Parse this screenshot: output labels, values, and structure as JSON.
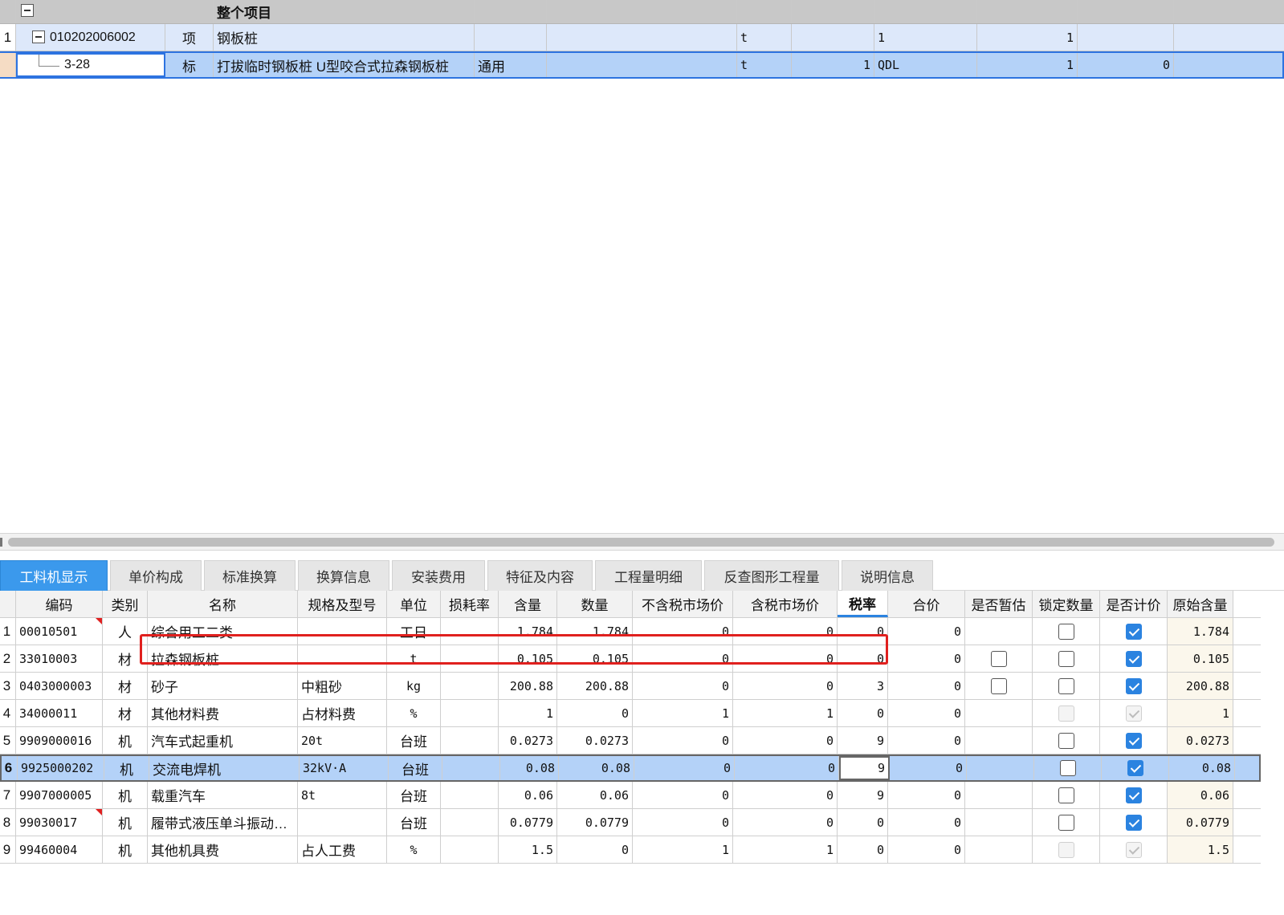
{
  "top_grid": {
    "header_title": "整个项目",
    "rows": [
      {
        "index": "1",
        "code": "010202006002",
        "category": "项",
        "name": "钢板桩",
        "spec": "",
        "col5": "",
        "unit": "t",
        "col7": "",
        "col8": "1",
        "col9": "1",
        "col10": ""
      },
      {
        "index": "",
        "code": "3-28",
        "category": "标",
        "name": "打拔临时钢板桩 U型咬合式拉森钢板桩",
        "spec": "通用",
        "col5": "",
        "unit": "t",
        "col7": "1",
        "col8": "QDL",
        "col9": "1",
        "col10": "0"
      }
    ]
  },
  "tabs": [
    "工料机显示",
    "单价构成",
    "标准换算",
    "换算信息",
    "安装费用",
    "特征及内容",
    "工程量明细",
    "反查图形工程量",
    "说明信息"
  ],
  "active_tab": "工料机显示",
  "bottom_grid": {
    "headers": [
      "编码",
      "类别",
      "名称",
      "规格及型号",
      "单位",
      "损耗率",
      "含量",
      "数量",
      "不含税市场价",
      "含税市场价",
      "税率",
      "合价",
      "是否暂估",
      "锁定数量",
      "是否计价",
      "原始含量"
    ],
    "rows": [
      {
        "index": "1",
        "code": "00010501",
        "type": "人",
        "name": "综合用工二类",
        "spec": "",
        "unit": "工日",
        "loss": "",
        "qty_per": "1.784",
        "qty": "1.784",
        "price_ex": "0",
        "price_in": "0",
        "tax": "0",
        "total": "0",
        "est": "none",
        "lock": "off",
        "priced": "on",
        "orig": "1.784"
      },
      {
        "index": "2",
        "code": "33010003",
        "type": "材",
        "name": "拉森钢板桩",
        "spec": "",
        "unit": "t",
        "loss": "",
        "qty_per": "0.105",
        "qty": "0.105",
        "price_ex": "0",
        "price_in": "0",
        "tax": "0",
        "total": "0",
        "est": "off",
        "lock": "off",
        "priced": "on",
        "orig": "0.105"
      },
      {
        "index": "3",
        "code": "0403000003",
        "type": "材",
        "name": "砂子",
        "spec": "中粗砂",
        "unit": "kg",
        "loss": "",
        "qty_per": "200.88",
        "qty": "200.88",
        "price_ex": "0",
        "price_in": "0",
        "tax": "3",
        "total": "0",
        "est": "off",
        "lock": "off",
        "priced": "on",
        "orig": "200.88"
      },
      {
        "index": "4",
        "code": "34000011",
        "type": "材",
        "name": "其他材料费",
        "spec": "占材料费",
        "unit": "%",
        "loss": "",
        "qty_per": "1",
        "qty": "0",
        "price_ex": "1",
        "price_in": "1",
        "tax": "0",
        "total": "0",
        "est": "none",
        "lock": "dis",
        "priced": "dis-on",
        "orig": "1"
      },
      {
        "index": "5",
        "code": "9909000016",
        "type": "机",
        "name": "汽车式起重机",
        "spec": "20t",
        "unit": "台班",
        "loss": "",
        "qty_per": "0.0273",
        "qty": "0.0273",
        "price_ex": "0",
        "price_in": "0",
        "tax": "9",
        "total": "0",
        "est": "none",
        "lock": "off",
        "priced": "on",
        "orig": "0.0273"
      },
      {
        "index": "6",
        "code": "9925000202",
        "type": "机",
        "name": "交流电焊机",
        "spec": "32kV·A",
        "unit": "台班",
        "loss": "",
        "qty_per": "0.08",
        "qty": "0.08",
        "price_ex": "0",
        "price_in": "0",
        "tax": "9",
        "total": "0",
        "est": "none",
        "lock": "off",
        "priced": "on",
        "orig": "0.08"
      },
      {
        "index": "7",
        "code": "9907000005",
        "type": "机",
        "name": "载重汽车",
        "spec": "8t",
        "unit": "台班",
        "loss": "",
        "qty_per": "0.06",
        "qty": "0.06",
        "price_ex": "0",
        "price_in": "0",
        "tax": "9",
        "total": "0",
        "est": "none",
        "lock": "off",
        "priced": "on",
        "orig": "0.06"
      },
      {
        "index": "8",
        "code": "99030017",
        "type": "机",
        "name": "履带式液压单斗振动…",
        "spec": "",
        "unit": "台班",
        "loss": "",
        "qty_per": "0.0779",
        "qty": "0.0779",
        "price_ex": "0",
        "price_in": "0",
        "tax": "0",
        "total": "0",
        "est": "none",
        "lock": "off",
        "priced": "on",
        "orig": "0.0779"
      },
      {
        "index": "9",
        "code": "99460004",
        "type": "机",
        "name": "其他机具费",
        "spec": "占人工费",
        "unit": "%",
        "loss": "",
        "qty_per": "1.5",
        "qty": "0",
        "price_ex": "1",
        "price_in": "1",
        "tax": "0",
        "total": "0",
        "est": "none",
        "lock": "dis",
        "priced": "dis-on",
        "orig": "1.5"
      }
    ],
    "selected_row_index": "6",
    "highlighted_row_index": "2",
    "flagged_row_indices": [
      "1",
      "8"
    ]
  },
  "colors": {
    "accent": "#3b99ec",
    "selected_row": "#b4d2f8",
    "highlight_box": "#e0201e",
    "top_row_bg": "#dde8fa",
    "header_bg": "#c8c8c8"
  }
}
